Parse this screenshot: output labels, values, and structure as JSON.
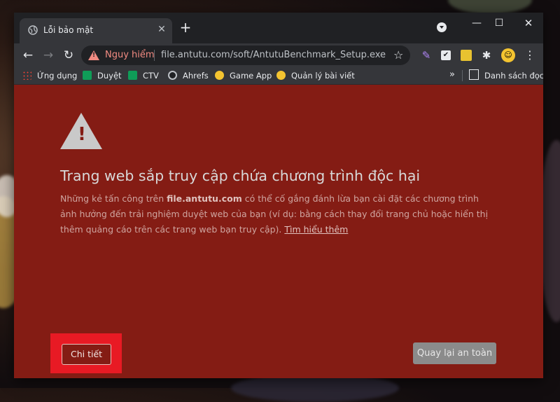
{
  "tab": {
    "title": "Lỗi bảo mật",
    "close": "✕",
    "new_tab": "+"
  },
  "window_controls": {
    "minimize": "—",
    "maximize": "☐",
    "close": "✕"
  },
  "toolbar": {
    "back": "←",
    "forward": "→",
    "reload": "↻",
    "security_label": "Nguy hiểm",
    "url": "file.antutu.com/soft/AntutuBenchmark_Setup.exe",
    "star": "☆",
    "menu": "⋮"
  },
  "bookmarks": {
    "items": [
      "Ứng dụng",
      "Duyệt",
      "CTV",
      "Ahrefs",
      "Game App",
      "Quản lý bài viết"
    ],
    "more": "»",
    "reading_list": "Danh sách đọc"
  },
  "interstitial": {
    "warning_mark": "!",
    "headline": "Trang web sắp truy cập chứa chương trình độc hại",
    "para_prefix": "Những kẻ tấn công trên ",
    "para_domain": "file.antutu.com",
    "para_suffix": " có thể cố gắng đánh lừa bạn cài đặt các chương trình ảnh hưởng đến trải nghiệm duyệt web của bạn (ví dụ: bằng cách thay đổi trang chủ hoặc hiển thị thêm quảng cáo trên các trang web bạn truy cập). ",
    "learn_more": "Tìm hiểu thêm",
    "details_button": "Chi tiết",
    "back_button": "Quay lại an toàn"
  },
  "colors": {
    "page_background": "#841c14",
    "danger_text": "#f28b82",
    "highlight_box": "#e81a24"
  }
}
